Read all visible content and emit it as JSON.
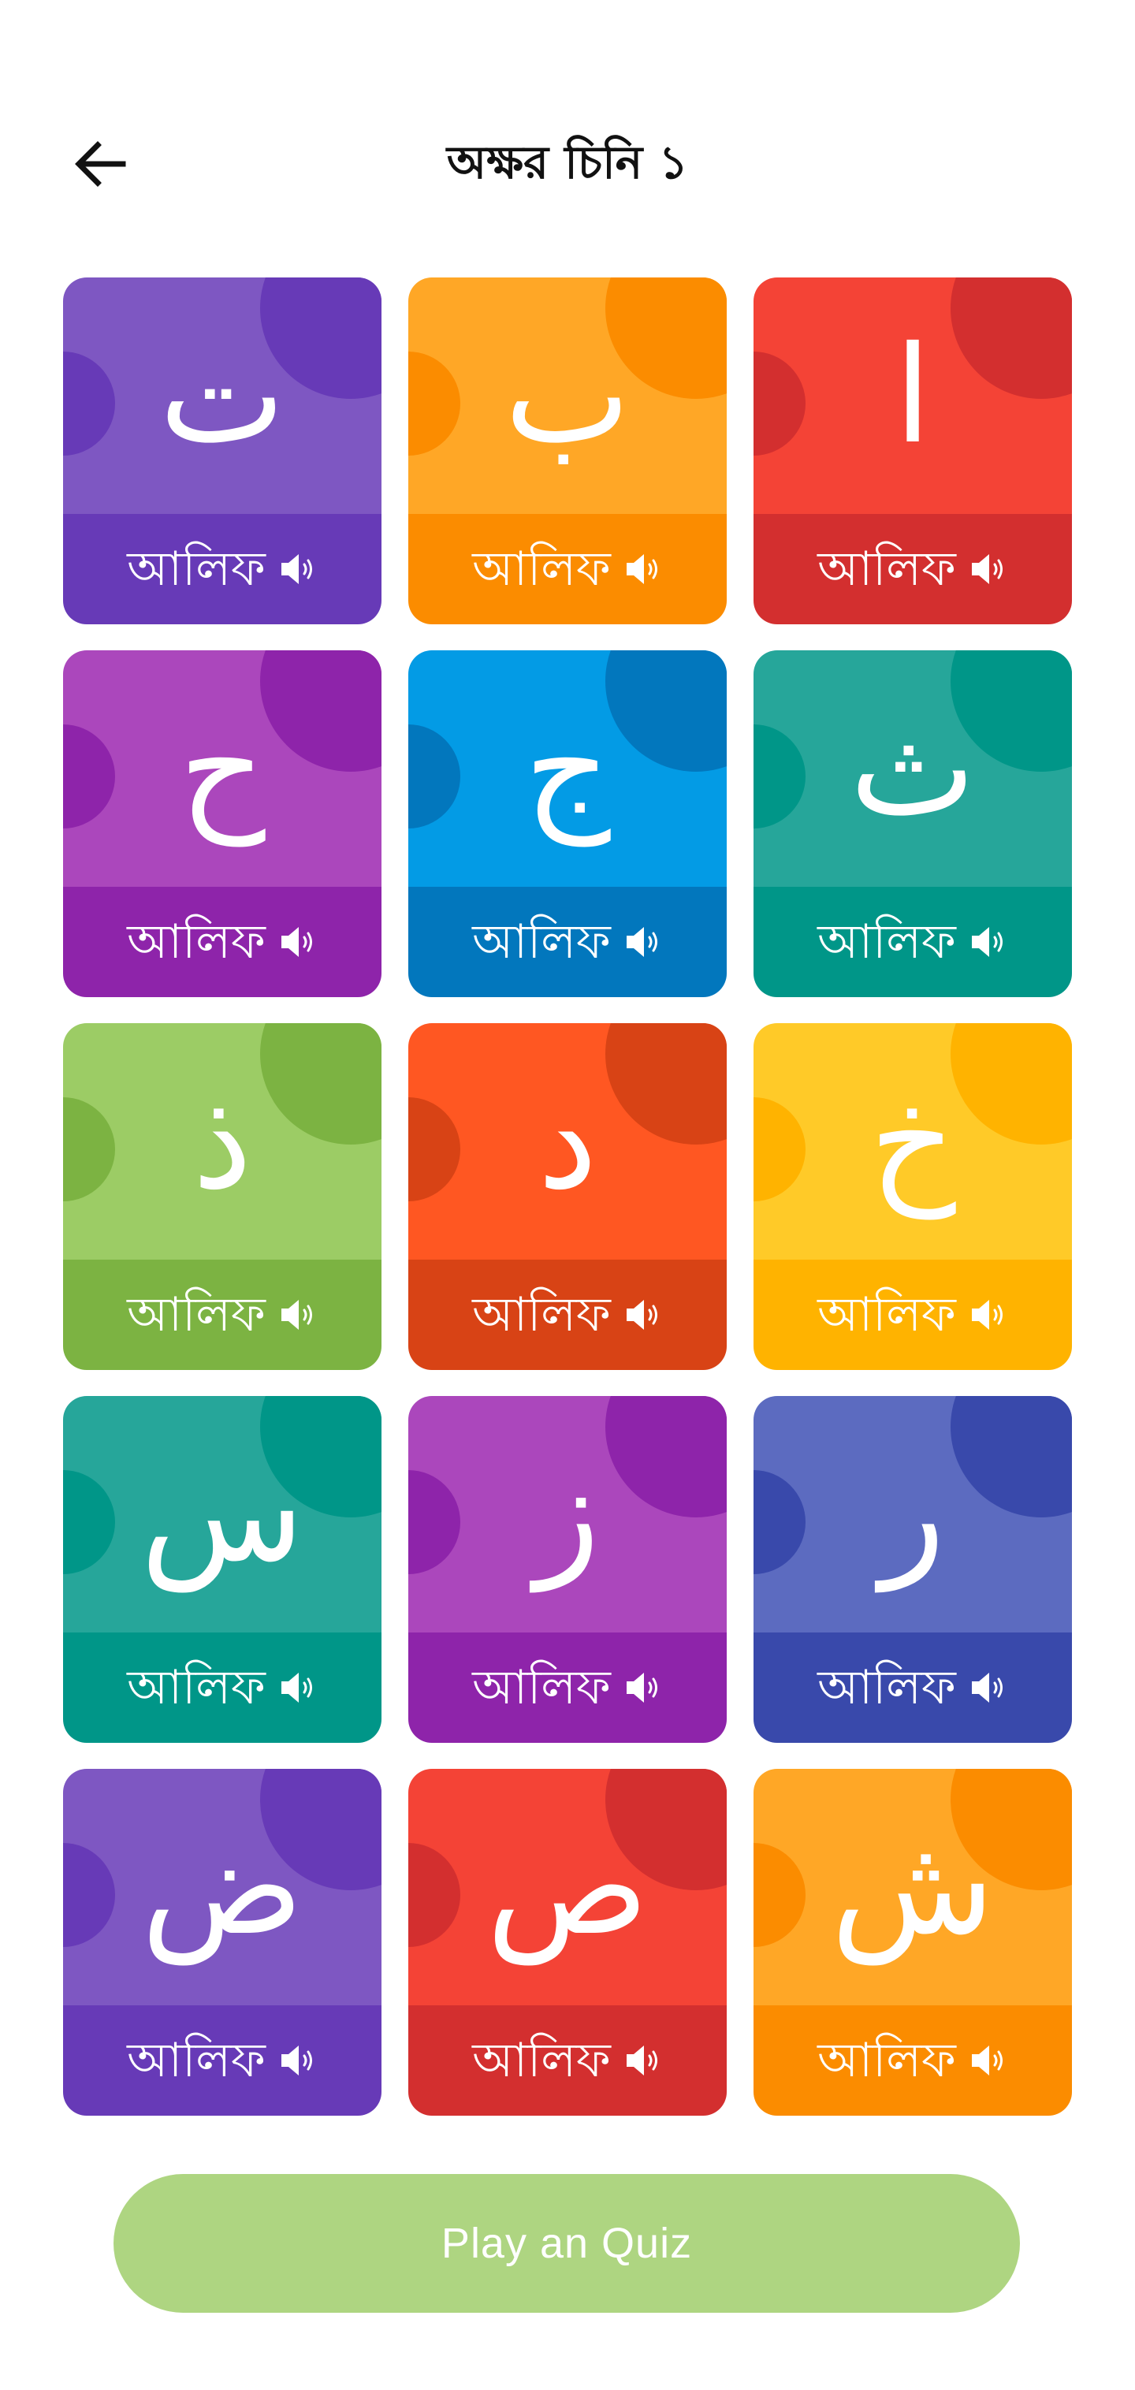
{
  "header": {
    "title": "অক্ষর চিনি ১",
    "back_icon": "arrow-left-icon"
  },
  "cards": [
    {
      "letter": "ت",
      "name": "আলিফ",
      "color_top": "#7e57c2",
      "color_bottom": "#673ab7",
      "icon": "speaker-icon"
    },
    {
      "letter": "ب",
      "name": "আলিফ",
      "color_top": "#ffa726",
      "color_bottom": "#fb8c00",
      "icon": "speaker-icon"
    },
    {
      "letter": "ا",
      "name": "আলিফ",
      "color_top": "#f44336",
      "color_bottom": "#d32f2f",
      "icon": "speaker-icon"
    },
    {
      "letter": "ح",
      "name": "আলিফ",
      "color_top": "#ab47bc",
      "color_bottom": "#8e24aa",
      "icon": "speaker-icon"
    },
    {
      "letter": "ج",
      "name": "আলিফ",
      "color_top": "#039be5",
      "color_bottom": "#0277bd",
      "icon": "speaker-icon"
    },
    {
      "letter": "ث",
      "name": "আলিফ",
      "color_top": "#26a69a",
      "color_bottom": "#009688",
      "icon": "speaker-icon"
    },
    {
      "letter": "ذ",
      "name": "আলিফ",
      "color_top": "#9ccc65",
      "color_bottom": "#7cb342",
      "icon": "speaker-icon"
    },
    {
      "letter": "د",
      "name": "আলিফ",
      "color_top": "#ff5722",
      "color_bottom": "#d84315",
      "icon": "speaker-icon"
    },
    {
      "letter": "خ",
      "name": "আলিফ",
      "color_top": "#ffca28",
      "color_bottom": "#ffb300",
      "icon": "speaker-icon"
    },
    {
      "letter": "س",
      "name": "আলিফ",
      "color_top": "#26a69a",
      "color_bottom": "#009688",
      "icon": "speaker-icon"
    },
    {
      "letter": "ز",
      "name": "আলিফ",
      "color_top": "#ab47bc",
      "color_bottom": "#8e24aa",
      "icon": "speaker-icon"
    },
    {
      "letter": "ر",
      "name": "আলিফ",
      "color_top": "#5c6bc0",
      "color_bottom": "#3949ab",
      "icon": "speaker-icon"
    },
    {
      "letter": "ض",
      "name": "আলিফ",
      "color_top": "#7e57c2",
      "color_bottom": "#673ab7",
      "icon": "speaker-icon"
    },
    {
      "letter": "ص",
      "name": "আলিফ",
      "color_top": "#f44336",
      "color_bottom": "#d32f2f",
      "icon": "speaker-icon"
    },
    {
      "letter": "ش",
      "name": "আলিফ",
      "color_top": "#ffa726",
      "color_bottom": "#fb8c00",
      "icon": "speaker-icon"
    }
  ],
  "quiz_button": {
    "label": "Play an Quiz",
    "color": "#aed581"
  }
}
